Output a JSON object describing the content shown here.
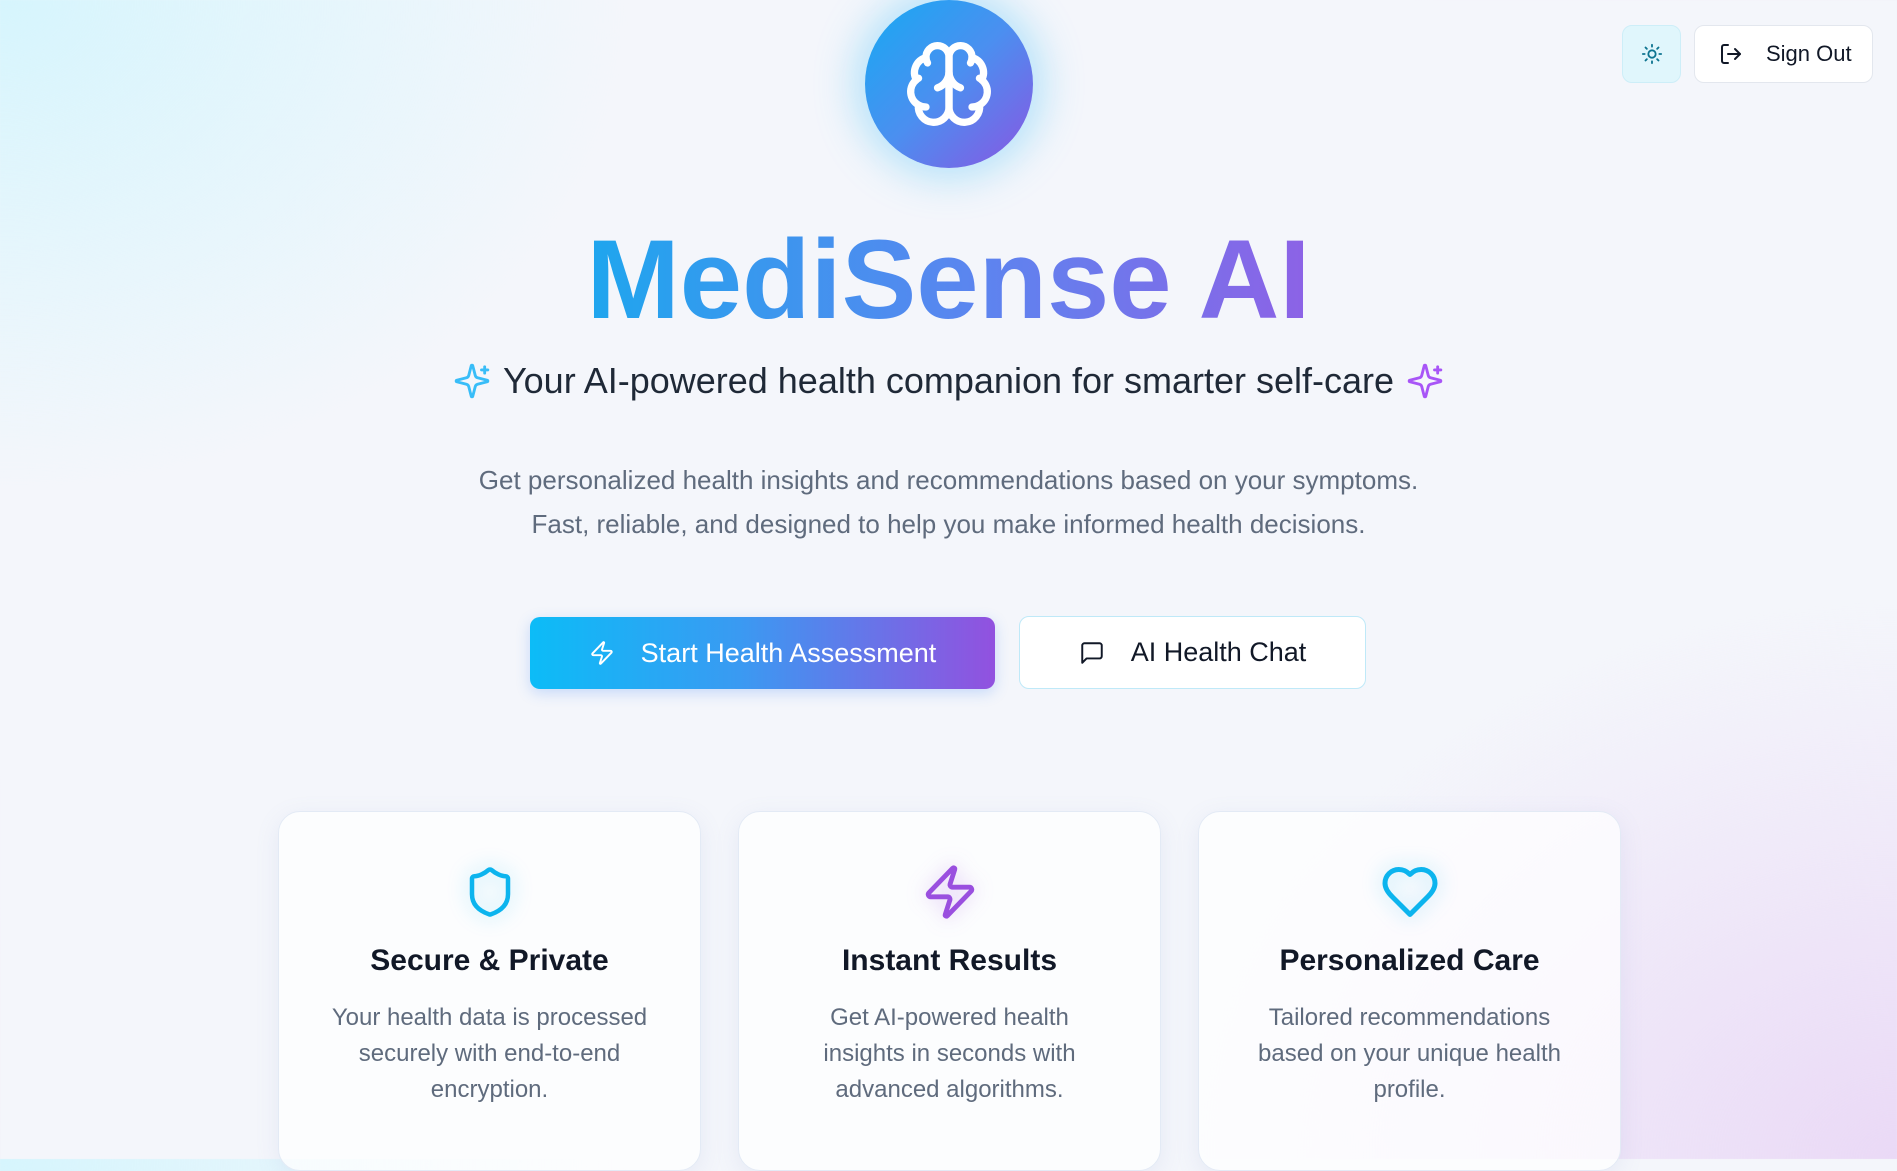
{
  "header": {
    "theme_toggle_icon": "sun-icon",
    "sign_out_label": "Sign Out",
    "sign_out_icon": "log-out-icon"
  },
  "hero": {
    "logo_icon": "brain-icon",
    "title": "MediSense AI",
    "subtitle": "Your AI-powered health companion for smarter self-care",
    "description_line1": "Get personalized health insights and recommendations based on your symptoms.",
    "description_line2": "Fast, reliable, and designed to help you make informed health decisions.",
    "primary_button": "Start Health Assessment",
    "secondary_button": "AI Health Chat"
  },
  "features": [
    {
      "icon": "shield-icon",
      "title": "Secure & Private",
      "text": "Your health data is processed securely with end-to-end encryption."
    },
    {
      "icon": "zap-icon",
      "title": "Instant Results",
      "text": "Get AI-powered health insights in seconds with advanced algorithms."
    },
    {
      "icon": "heart-icon",
      "title": "Personalized Care",
      "text": "Tailored recommendations based on your unique health profile."
    }
  ],
  "colors": {
    "accent_cyan": "#0cbcf7",
    "accent_blue": "#3a9af2",
    "accent_purple": "#9251df"
  }
}
